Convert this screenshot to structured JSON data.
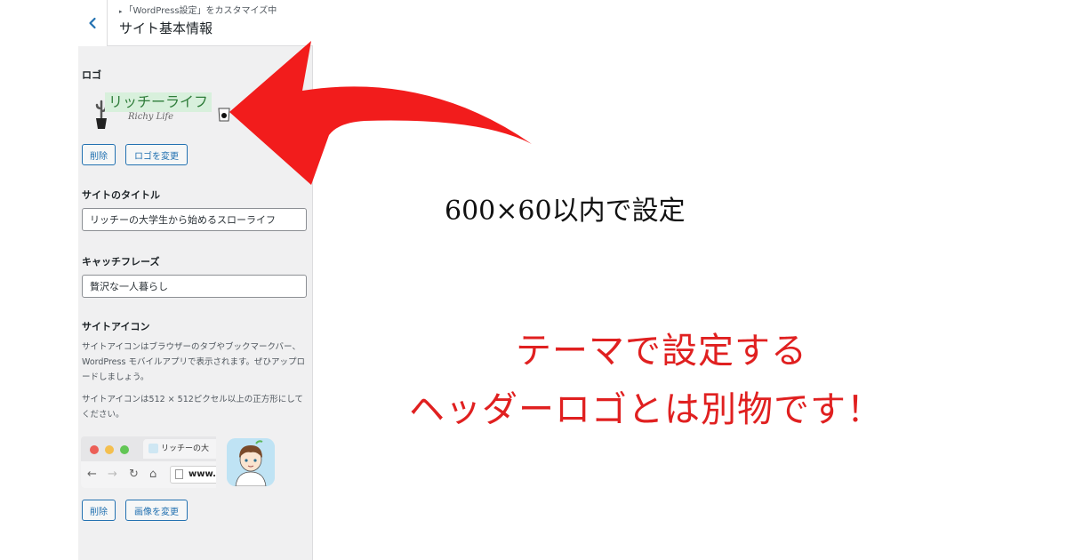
{
  "header": {
    "breadcrumb": "「WordPress設定」をカスタマイズ中",
    "title": "サイト基本情報"
  },
  "logo_section": {
    "label": "ロゴ",
    "logo_text": "リッチーライフ",
    "logo_subtext": "Richy Life",
    "remove_label": "削除",
    "change_label": "ロゴを変更"
  },
  "site_title": {
    "label": "サイトのタイトル",
    "value": "リッチーの大学生から始めるスローライフ"
  },
  "tagline": {
    "label": "キャッチフレーズ",
    "value": "贅沢な一人暮らし"
  },
  "site_icon": {
    "label": "サイトアイコン",
    "description": "サイトアイコンはブラウザーのタブやブックマークバー、WordPress モバイルアプリで表示されます。ぜひアップロードしましょう。",
    "size_note": "サイトアイコンは512 × 512ピクセル以上の正方形にしてください。",
    "preview_tab": "リッチーの大",
    "preview_address": "www.",
    "remove_label": "削除",
    "change_label": "画像を変更"
  },
  "annotations": {
    "size_note": "600×60以内で設定",
    "line1": "テーマで設定する",
    "line2": "ヘッダーロゴとは別物です！"
  },
  "colors": {
    "accent": "#2271b1",
    "annotation_red": "#e02020",
    "arrow_red": "#f21c1c",
    "panel_bg": "#f0f0f1"
  }
}
